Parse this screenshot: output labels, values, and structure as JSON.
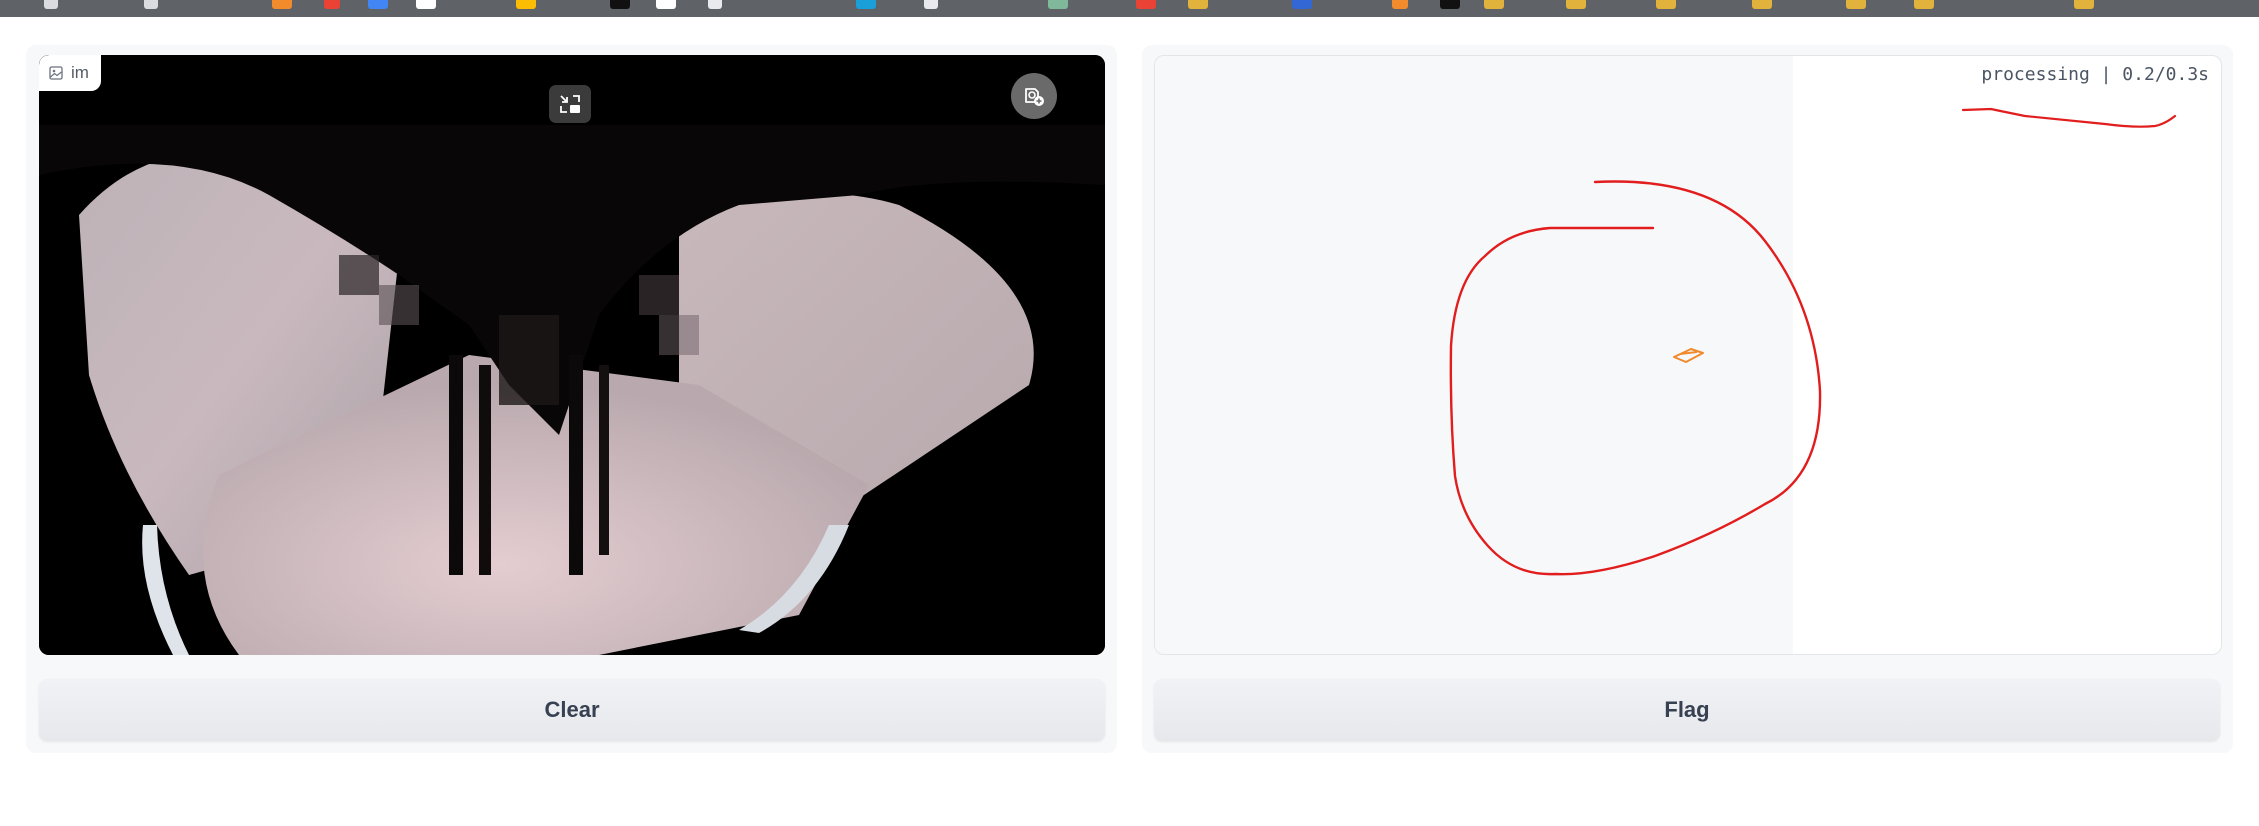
{
  "input_panel": {
    "image_label": "im",
    "clear_button_label": "Clear",
    "fullscreen_icon": "exit-fullscreen-icon",
    "webcam_icon": "webcam-switch-icon"
  },
  "output_panel": {
    "status": "processing | 0.2/0.3s",
    "flag_button_label": "Flag"
  },
  "colors": {
    "sketch_stroke": "#e11d1d",
    "marker": "#f08a2c",
    "button_bg": "#eceef1",
    "panel_bg": "#f7f8fa"
  }
}
